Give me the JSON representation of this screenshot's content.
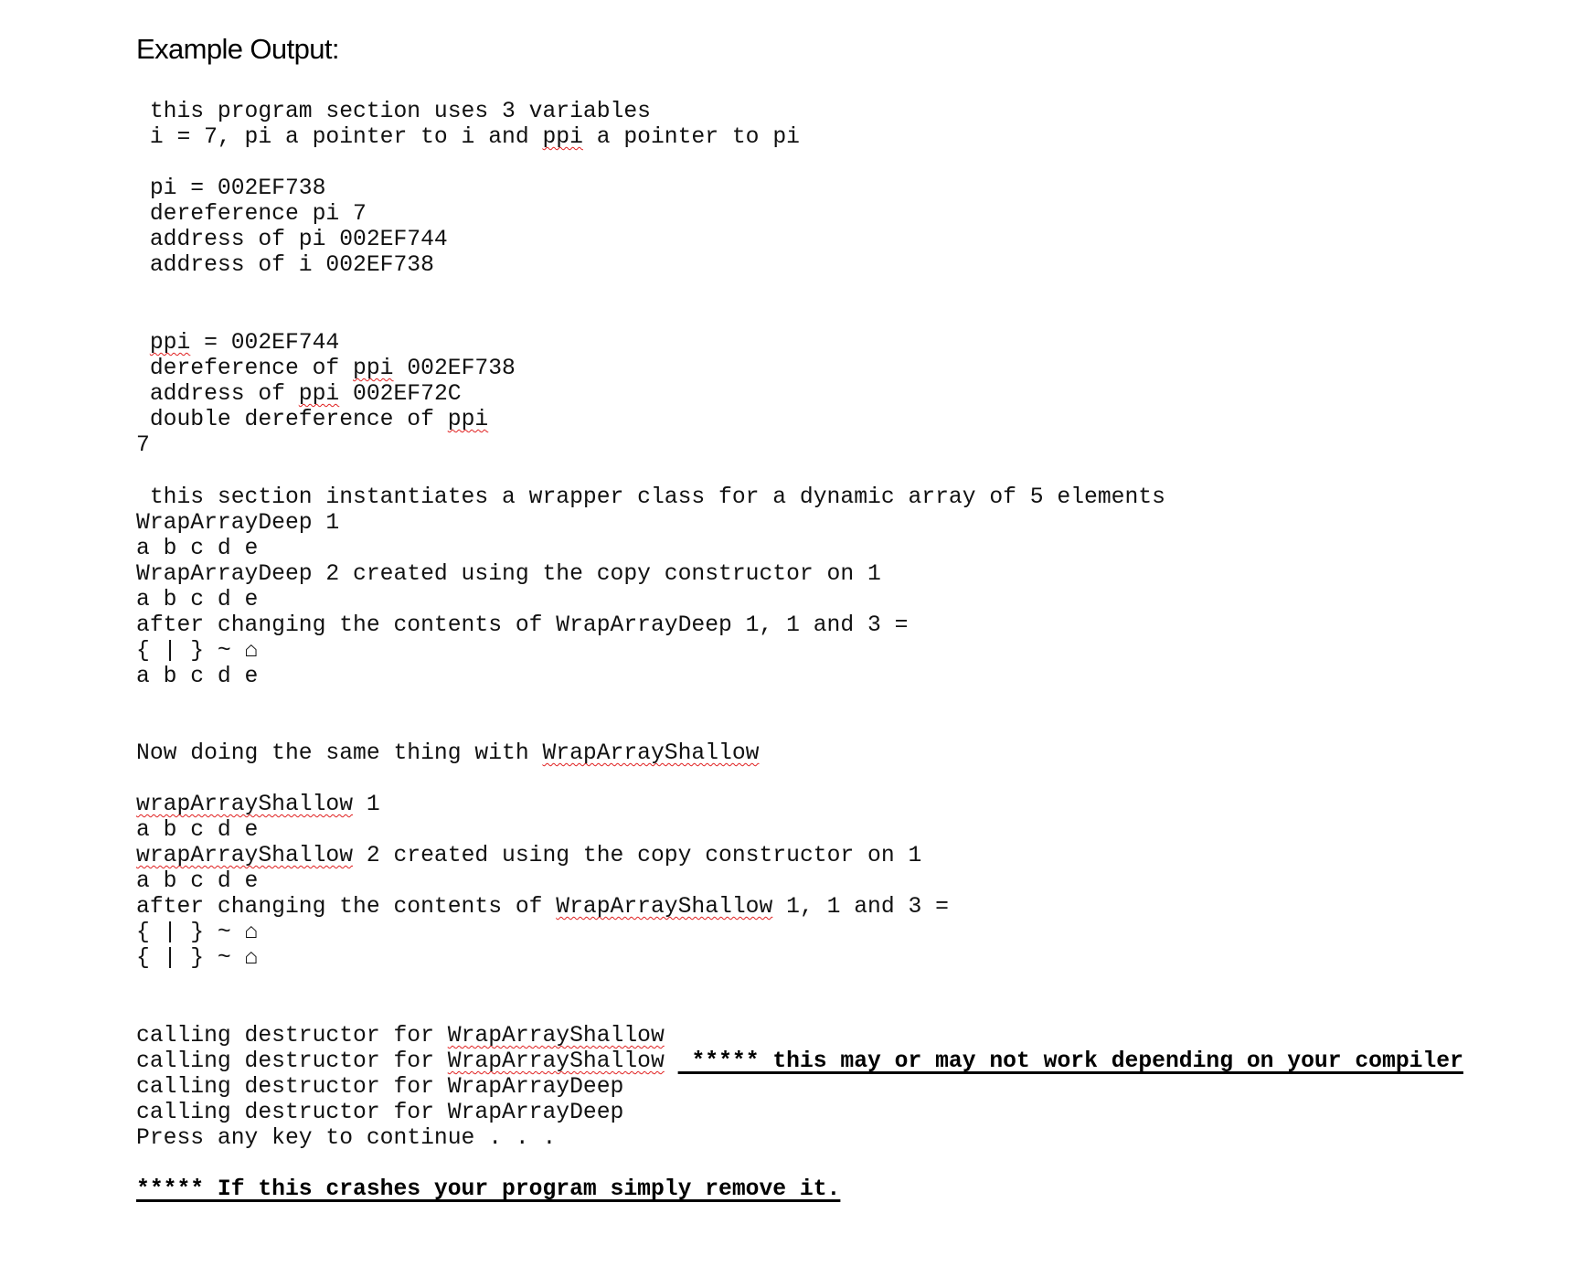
{
  "title": "Example Output:",
  "section1": {
    "intro": [
      " this program section uses 3 variables",
      " i = 7, pi a pointer to i and ",
      "ppi",
      " a pointer to pi"
    ],
    "pi_lines": [
      " pi = 002EF738",
      " dereference pi 7",
      " address of pi 002EF744",
      " address of i 002EF738"
    ],
    "ppi_lines": {
      "l1_a": " ",
      "l1_b": "ppi",
      "l1_c": " = 002EF744",
      "l2_a": " dereference of ",
      "l2_b": "ppi",
      "l2_c": " 002EF738",
      "l3_a": " address of ",
      "l3_b": "ppi",
      "l3_c": " 002EF72C",
      "l4_a": " double dereference of ",
      "l4_b": "ppi",
      "l5": "7"
    }
  },
  "section2": {
    "lines": [
      " this section instantiates a wrapper class for a dynamic array of 5 elements",
      "WrapArrayDeep 1",
      "a b c d e",
      "WrapArrayDeep 2 created using the copy constructor on 1",
      "a b c d e",
      "after changing the contents of WrapArrayDeep 1, 1 and 3 =",
      "{ | } ~ ⌂",
      "a b c d e"
    ]
  },
  "section3": {
    "heading_a": "Now doing the same thing with ",
    "heading_b": "WrapArrayShallow",
    "l1_a": "wrapArrayShallow",
    "l1_b": " 1",
    "l2": "a b c d e",
    "l3_a": "wrapArrayShallow",
    "l3_b": " 2 created using the copy constructor on 1",
    "l4": "a b c d e",
    "l5_a": "after changing the contents of ",
    "l5_b": "WrapArrayShallow",
    "l5_c": " 1, 1 and 3 =",
    "l6": "{ | } ~ ⌂",
    "l7": "{ | } ~ ⌂"
  },
  "section4": {
    "d1_a": "calling destructor for ",
    "d1_b": "WrapArrayShallow",
    "d2_a": "calling destructor for ",
    "d2_b": "WrapArrayShallow",
    "d2_gap": " ",
    "d2_note": " ***** this may or may not work depending on your compiler",
    "d3": "calling destructor for WrapArrayDeep",
    "d4": "calling destructor for WrapArrayDeep",
    "press": "Press any key to continue . . .",
    "crash_note": "***** If this crashes your program simply remove it."
  }
}
